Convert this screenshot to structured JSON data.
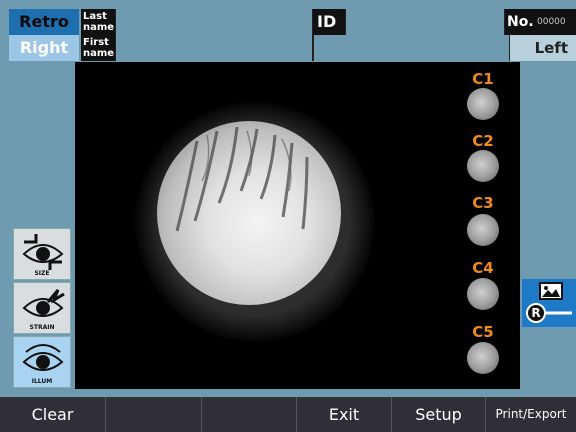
{
  "header": {
    "retro_label": "Retro",
    "last_name_label": "Last name",
    "id_label": "ID",
    "no_label": "No.",
    "no_value": "00000",
    "right_label": "Right",
    "first_name_label": "First name",
    "left_label": "Left"
  },
  "thumbnails": [
    {
      "label": "C1"
    },
    {
      "label": "C2"
    },
    {
      "label": "C3"
    },
    {
      "label": "C4"
    },
    {
      "label": "C5"
    }
  ],
  "tools": [
    {
      "label": "SIZE",
      "icon": "eye-size-icon"
    },
    {
      "label": "STRAIN",
      "icon": "eye-strain-icon"
    },
    {
      "label": "ILLUM",
      "icon": "eye-illum-icon"
    }
  ],
  "right_button": {
    "icon": "image-r-icon",
    "letter": "R"
  },
  "bottom_bar": {
    "buttons": [
      "Clear",
      "",
      "",
      "Exit",
      "Setup",
      "Print/Export"
    ]
  },
  "colors": {
    "background": "#6f9bb0",
    "accent_blue": "#1e79c6",
    "thumb_label": "#f08a1c",
    "bottom_bar": "#2f2f35"
  }
}
